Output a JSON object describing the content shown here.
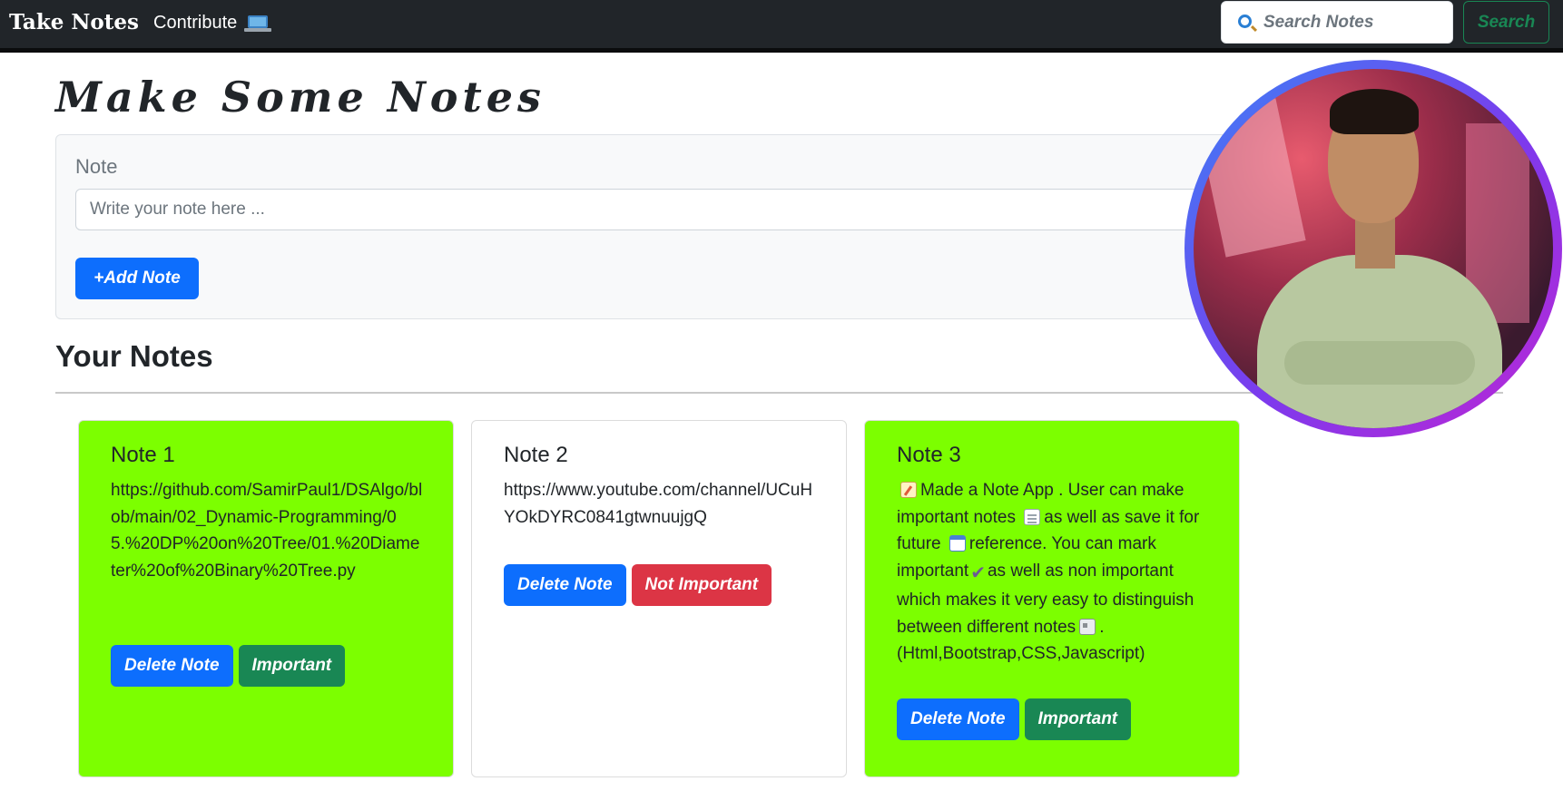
{
  "navbar": {
    "brand": "Take Notes",
    "contribute_label": "Contribute",
    "contribute_icon": "laptop-icon",
    "search_placeholder": "Search Notes",
    "search_icon": "search-icon",
    "search_button": "Search"
  },
  "form": {
    "heading": "Make Some Notes",
    "note_label": "Note",
    "note_placeholder": "Write your note here ...",
    "add_button": "+Add Note"
  },
  "notes_section": {
    "title": "Your Notes"
  },
  "notes": [
    {
      "title": "Note 1",
      "text": "https://github.com/SamirPaul1/DSAlgo/blob/main/02_Dynamic-Programming/05.%20DP%20on%20Tree/01.%20Diameter%20of%20Binary%20Tree.py",
      "delete_label": "Delete Note",
      "toggle_label": "Important",
      "color": "#7cff00"
    },
    {
      "title": "Note 2",
      "text": "https://www.youtube.com/channel/UCuHYOkDYRC0841gtwnuujgQ",
      "delete_label": "Delete Note",
      "toggle_label": "Not Important",
      "color": "#ffffff"
    },
    {
      "title": "Note 3",
      "text_parts": [
        "Made a Note App . User can make important notes",
        "as well as save it for future",
        "reference. You can mark important",
        "as well as non important which makes it very easy to distinguish between different notes",
        ". (Html,Bootstrap,CSS,Javascript)"
      ],
      "icons": [
        "memo-icon",
        "page-icon",
        "calendar-icon",
        "check-icon",
        "newspaper-icon"
      ],
      "delete_label": "Delete Note",
      "toggle_label": "Important",
      "color": "#7cff00"
    }
  ],
  "avatar": {
    "icon": "profile-photo"
  },
  "colors": {
    "navbar_bg": "#212529",
    "primary": "#0d6efd",
    "success": "#198754",
    "danger": "#dc3545",
    "important_card": "#7cff00"
  }
}
